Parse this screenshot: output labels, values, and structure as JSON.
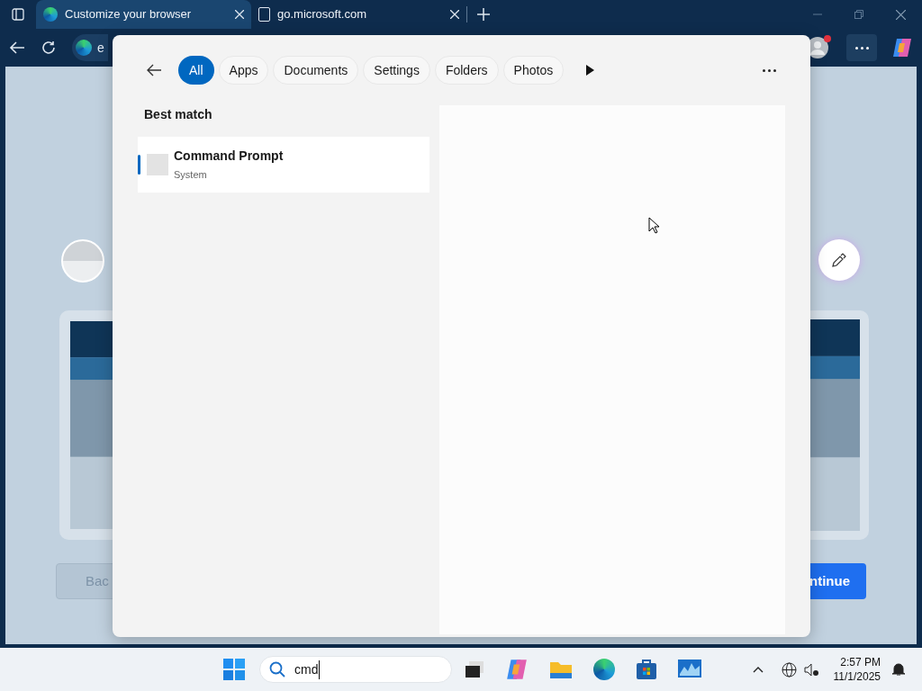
{
  "browser": {
    "tabs": [
      {
        "title": "Customize your browser",
        "selected": true
      },
      {
        "title": "go.microsoft.com",
        "selected": false
      }
    ],
    "address": "e",
    "page": {
      "back_button": "Bac",
      "continue_button": "ntinue"
    }
  },
  "search_flyout": {
    "filters": [
      {
        "label": "All",
        "selected": true
      },
      {
        "label": "Apps",
        "selected": false
      },
      {
        "label": "Documents",
        "selected": false
      },
      {
        "label": "Settings",
        "selected": false
      },
      {
        "label": "Folders",
        "selected": false
      },
      {
        "label": "Photos",
        "selected": false
      }
    ],
    "section": "Best match",
    "results": [
      {
        "name": "Command Prompt",
        "type": "System",
        "selected": true
      }
    ]
  },
  "taskbar": {
    "search": "cmd",
    "time": "2:57 PM",
    "date": "11/1/2025"
  }
}
